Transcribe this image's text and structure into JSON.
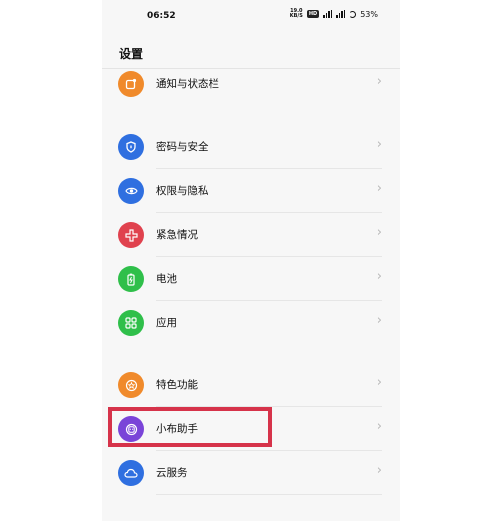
{
  "status_bar": {
    "time": "06:52",
    "net_speed_top": "19.0",
    "net_speed_bottom": "KB/S",
    "hd_badge": "HD",
    "battery_pct": "53%"
  },
  "header": {
    "title": "设置"
  },
  "groups": [
    {
      "items": [
        {
          "label": "通知与状态栏",
          "icon": "notification-icon",
          "color": "#f08a2b"
        }
      ]
    },
    {
      "items": [
        {
          "label": "密码与安全",
          "icon": "shield-icon",
          "color": "#2f6fe0"
        },
        {
          "label": "权限与隐私",
          "icon": "eye-privacy-icon",
          "color": "#2f6fe0"
        },
        {
          "label": "紧急情况",
          "icon": "emergency-icon",
          "color": "#e0424e"
        },
        {
          "label": "电池",
          "icon": "battery-icon",
          "color": "#2fbf4a"
        },
        {
          "label": "应用",
          "icon": "apps-grid-icon",
          "color": "#2fbf4a"
        }
      ]
    },
    {
      "items": [
        {
          "label": "特色功能",
          "icon": "star-icon",
          "color": "#f08a2b"
        },
        {
          "label": "小布助手",
          "icon": "assistant-icon",
          "color": "#7a44d8"
        },
        {
          "label": "云服务",
          "icon": "cloud-icon",
          "color": "#2f6fe0"
        }
      ]
    }
  ],
  "chevron": "›"
}
